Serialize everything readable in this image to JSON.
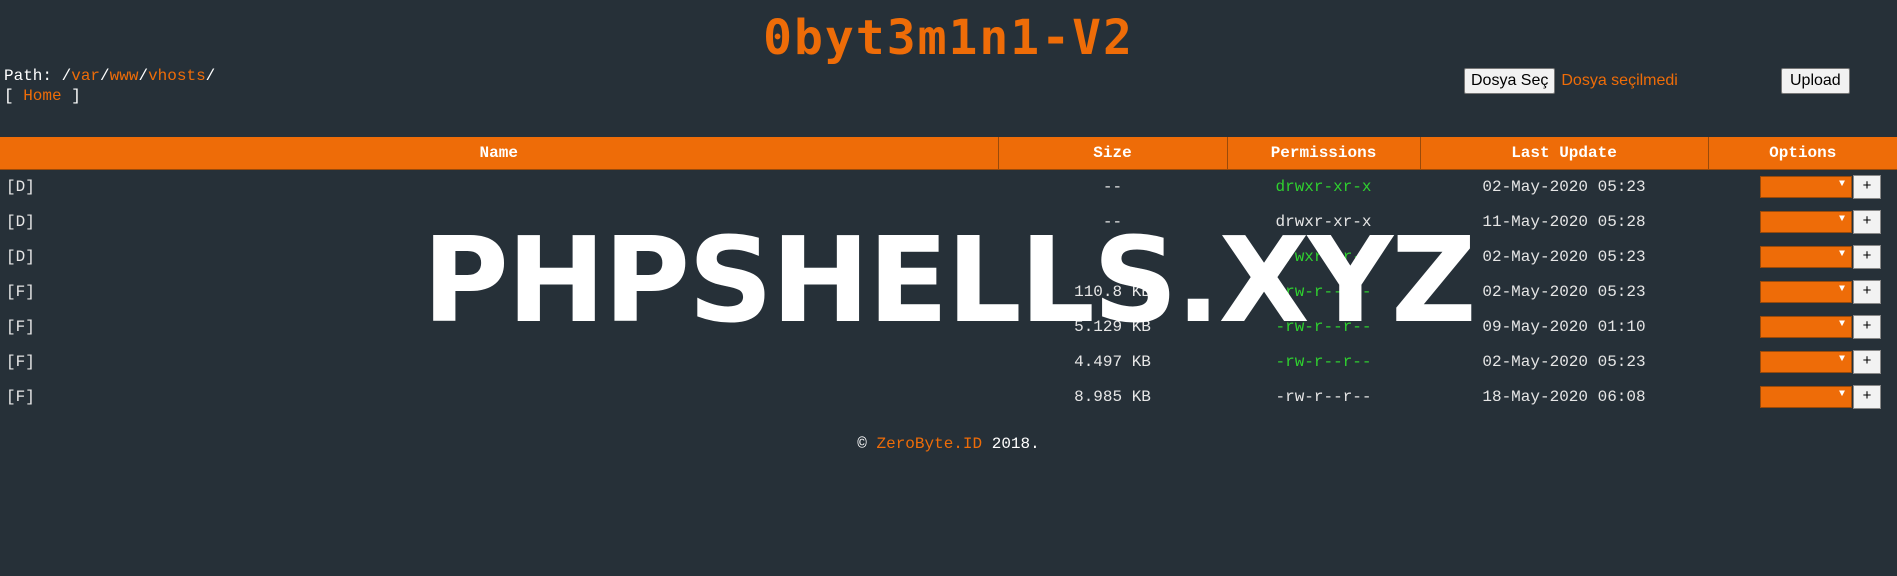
{
  "header": {
    "title": "0byt3m1n1-V2",
    "path_label": "Path: ",
    "path_segments": [
      "var",
      "www",
      "vhosts"
    ],
    "home_link": "Home"
  },
  "upload": {
    "choose_label": "Dosya Seç",
    "no_file_text": "Dosya seçilmedi",
    "upload_label": "Upload"
  },
  "table": {
    "columns": [
      "Name",
      "Size",
      "Permissions",
      "Last Update",
      "Options"
    ],
    "rows": [
      {
        "name": "[D]",
        "size": "--",
        "perm": "drwxr-xr-x",
        "perm_color": "#2fd12f",
        "date": "02-May-2020 05:23"
      },
      {
        "name": "[D]",
        "size": "--",
        "perm": "drwxr-xr-x",
        "perm_color": "#e6e6e6",
        "date": "11-May-2020 05:28"
      },
      {
        "name": "[D]",
        "size": "--",
        "perm": "drwxr-xr-x",
        "perm_color": "#2fd12f",
        "date": "02-May-2020 05:23"
      },
      {
        "name": "[F]",
        "size": "110.8 KB",
        "perm": "-rw-r--r--",
        "perm_color": "#2fd12f",
        "date": "02-May-2020 05:23"
      },
      {
        "name": "[F]",
        "size": "5.129 KB",
        "perm": "-rw-r--r--",
        "perm_color": "#2fd12f",
        "date": "09-May-2020 01:10"
      },
      {
        "name": "[F]",
        "size": "4.497 KB",
        "perm": "-rw-r--r--",
        "perm_color": "#2fd12f",
        "date": "02-May-2020 05:23"
      },
      {
        "name": "[F]",
        "size": "8.985 KB",
        "perm": "-rw-r--r--",
        "perm_color": "#e6e6e6",
        "date": "18-May-2020 06:08"
      }
    ],
    "option_plus": "+"
  },
  "footer": {
    "copyright": "©",
    "brand": "ZeroByte.ID",
    "year": "2018."
  },
  "watermark": "PHPSHELLS.XYZ",
  "colors": {
    "accent": "#ee6c08",
    "background": "#263038",
    "perm_green": "#2fd12f"
  }
}
